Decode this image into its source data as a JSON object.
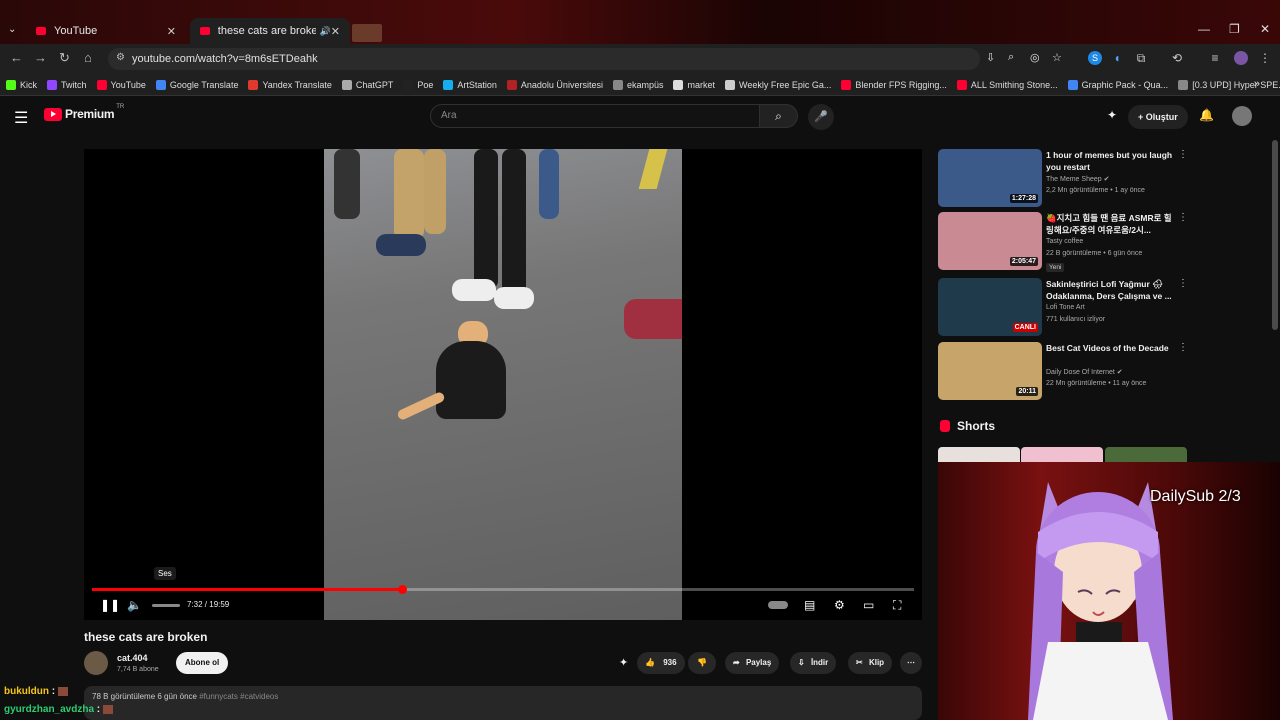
{
  "browser": {
    "tabs": [
      {
        "title": "YouTube"
      },
      {
        "title": "these cats are broken - You"
      }
    ],
    "url": "youtube.com/watch?v=8m6sETDeahk",
    "bookmarks": [
      "Kick",
      "Twitch",
      "YouTube",
      "Google Translate",
      "Yandex Translate",
      "ChatGPT",
      "Poe",
      "ArtStation",
      "Anadolu Üniversitesi",
      "ekampüs",
      "market",
      "Weekly Free Epic Ga...",
      "Blender FPS Rigging...",
      "ALL Smithing Stone...",
      "Graphic Pack - Qua...",
      "[0.3 UPD] Hyper SPE..."
    ],
    "bookmark_colors": [
      "#53fc18",
      "#9146ff",
      "#ff0033",
      "#4285f4",
      "#e03a2e",
      "#aaaaaa",
      "#222222",
      "#13aff0",
      "#b22222",
      "#888888",
      "#dddddd",
      "#cccccc",
      "#ff0033",
      "#ff0033",
      "#4285f4",
      "#888888"
    ]
  },
  "yt": {
    "logo_text": "Premium",
    "logo_region": "TR",
    "search_placeholder": "Ara",
    "create_label": "+ Oluştur"
  },
  "player": {
    "tooltip": "Ses",
    "time": "7:32 / 19:59",
    "progress": 0.3775
  },
  "video": {
    "title": "these cats are broken",
    "channel": "cat.404",
    "subscribers": "7,74 B abone",
    "subscribe_label": "Abone ol",
    "likes": "936",
    "share_label": "Paylaş",
    "download_label": "İndir",
    "clip_label": "Klip",
    "views_date": "78 B görüntüleme  6 gün önce",
    "tags": "#funnycats #catvideos"
  },
  "recommendations": [
    {
      "title": "1 hour of memes but you laugh you restart",
      "channel": "The Meme Sheep ✔",
      "meta": "2,2 Mn görüntüleme • 1 ay önce",
      "duration": "1:27:28",
      "color": "#3b5a8a"
    },
    {
      "title": "🍓지치고 힘들 땐 음료 ASMR로 힐링해요/주중의 여유로움/2시...",
      "channel": "Tasty coffee",
      "meta": "22 B görüntüleme • 6 gün önce",
      "duration": "2:05:47",
      "badge": "Yeni",
      "color": "#c98a94"
    },
    {
      "title": "Sakinleştirici Lofi Yağmur 🌧 Odaklanma, Ders Çalışma ve ...",
      "channel": "Lofi Tone Art",
      "meta": "771 kullanıcı izliyor",
      "duration": "CANLI",
      "color": "#1f3a4a"
    },
    {
      "title": "Best Cat Videos of the Decade",
      "channel": "Daily Dose Of Internet ✔",
      "meta": "22 Mn görüntüleme • 11 ay önce",
      "duration": "20:11",
      "color": "#c7a46a"
    }
  ],
  "shorts_label": "Shorts",
  "overlay": {
    "dailysub": "DailySub 2/3"
  },
  "chat": [
    {
      "name": "bukuldun",
      "sep": " :"
    },
    {
      "name": "gyurdzhan_avdzha",
      "sep": " :"
    }
  ]
}
